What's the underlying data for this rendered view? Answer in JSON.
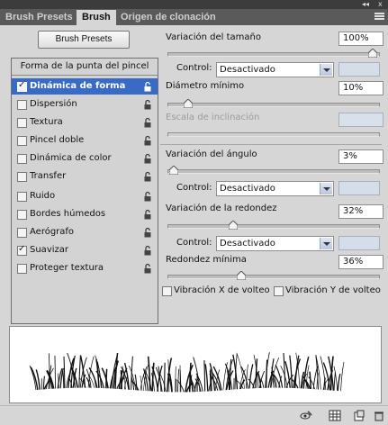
{
  "tabs": [
    "Brush Presets",
    "Brush",
    "Origen de clonación"
  ],
  "window_controls": {
    "collapse": "◂◂",
    "close": "x"
  },
  "presets_button": "Brush Presets",
  "options_list": {
    "header": "Forma de la punta del pincel",
    "items": [
      {
        "label": "Dinámica de forma",
        "checked": true,
        "selected": true,
        "locked": true
      },
      {
        "label": "Dispersión",
        "checked": false,
        "selected": false,
        "locked": true
      },
      {
        "label": "Textura",
        "checked": false,
        "selected": false,
        "locked": true
      },
      {
        "label": "Pincel doble",
        "checked": false,
        "selected": false,
        "locked": true
      },
      {
        "label": "Dinámica de color",
        "checked": false,
        "selected": false,
        "locked": true
      },
      {
        "label": "Transfer",
        "checked": false,
        "selected": false,
        "locked": true
      },
      {
        "label": "Ruido",
        "checked": false,
        "selected": false,
        "locked": true
      },
      {
        "label": "Bordes húmedos",
        "checked": false,
        "selected": false,
        "locked": true
      },
      {
        "label": "Aerógrafo",
        "checked": false,
        "selected": false,
        "locked": true
      },
      {
        "label": "Suavizar",
        "checked": true,
        "selected": false,
        "locked": true
      },
      {
        "label": "Proteger textura",
        "checked": false,
        "selected": false,
        "locked": true
      }
    ]
  },
  "settings": {
    "size_jitter": {
      "label": "Variación del tamaño",
      "value": "100%",
      "level": 1.0
    },
    "size_control": {
      "label": "Control:",
      "value": "Desactivado"
    },
    "min_diameter": {
      "label": "Diámetro mínimo",
      "value": "10%",
      "level": 0.1
    },
    "tilt_scale": {
      "label": "Escala de inclinación",
      "value": ""
    },
    "angle_jitter": {
      "label": "Variación del ángulo",
      "value": "3%",
      "level": 0.03
    },
    "angle_control": {
      "label": "Control:",
      "value": "Desactivado"
    },
    "roundness_jitter": {
      "label": "Variación de la redondez",
      "value": "32%",
      "level": 0.32
    },
    "roundness_control": {
      "label": "Control:",
      "value": "Desactivado"
    },
    "min_roundness": {
      "label": "Redondez mínima",
      "value": "36%",
      "level": 0.36
    },
    "flip_x": {
      "label": "Vibración X de volteo",
      "checked": false
    },
    "flip_y": {
      "label": "Vibración Y de volteo",
      "checked": false
    }
  },
  "bottom_icons": [
    "eye-brush-icon",
    "grid-icon",
    "new-preset-icon",
    "trash-icon"
  ],
  "colors": {
    "selection": "#3a6bc4",
    "panel": "#d6d6d6",
    "tabbar": "#5a5a5a"
  }
}
